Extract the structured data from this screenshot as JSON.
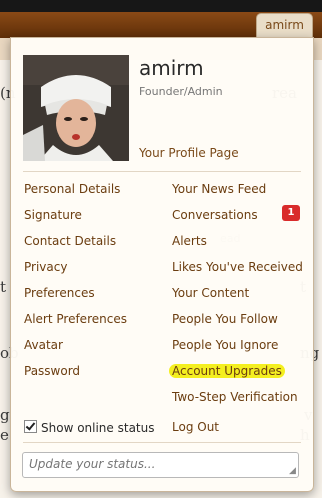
{
  "user_tab": {
    "label": "amirm"
  },
  "profile": {
    "username": "amirm",
    "title": "Founder/Admin",
    "profile_link": "Your Profile Page"
  },
  "menu_left": [
    {
      "label": "Personal Details"
    },
    {
      "label": "Signature"
    },
    {
      "label": "Contact Details"
    },
    {
      "label": "Privacy"
    },
    {
      "label": "Preferences"
    },
    {
      "label": "Alert Preferences"
    },
    {
      "label": "Avatar"
    },
    {
      "label": "Password"
    }
  ],
  "menu_right": [
    {
      "label": "Your News Feed"
    },
    {
      "label": "Conversations"
    },
    {
      "label": "Alerts"
    },
    {
      "label": "Likes You've Received"
    },
    {
      "label": "Your Content"
    },
    {
      "label": "People You Follow"
    },
    {
      "label": "People You Ignore"
    },
    {
      "label": "Account Upgrades"
    },
    {
      "label": "Two-Step Verification"
    },
    {
      "label": "Log Out"
    }
  ],
  "conversations_badge": "1",
  "online_status": {
    "label": "Show online status",
    "checked": true
  },
  "status_input": {
    "placeholder": "Update your status..."
  },
  "colors": {
    "link": "#6b3d10",
    "highlight": "#f4ef20",
    "badge": "#d92b2b",
    "nav": "#5e2e08"
  }
}
